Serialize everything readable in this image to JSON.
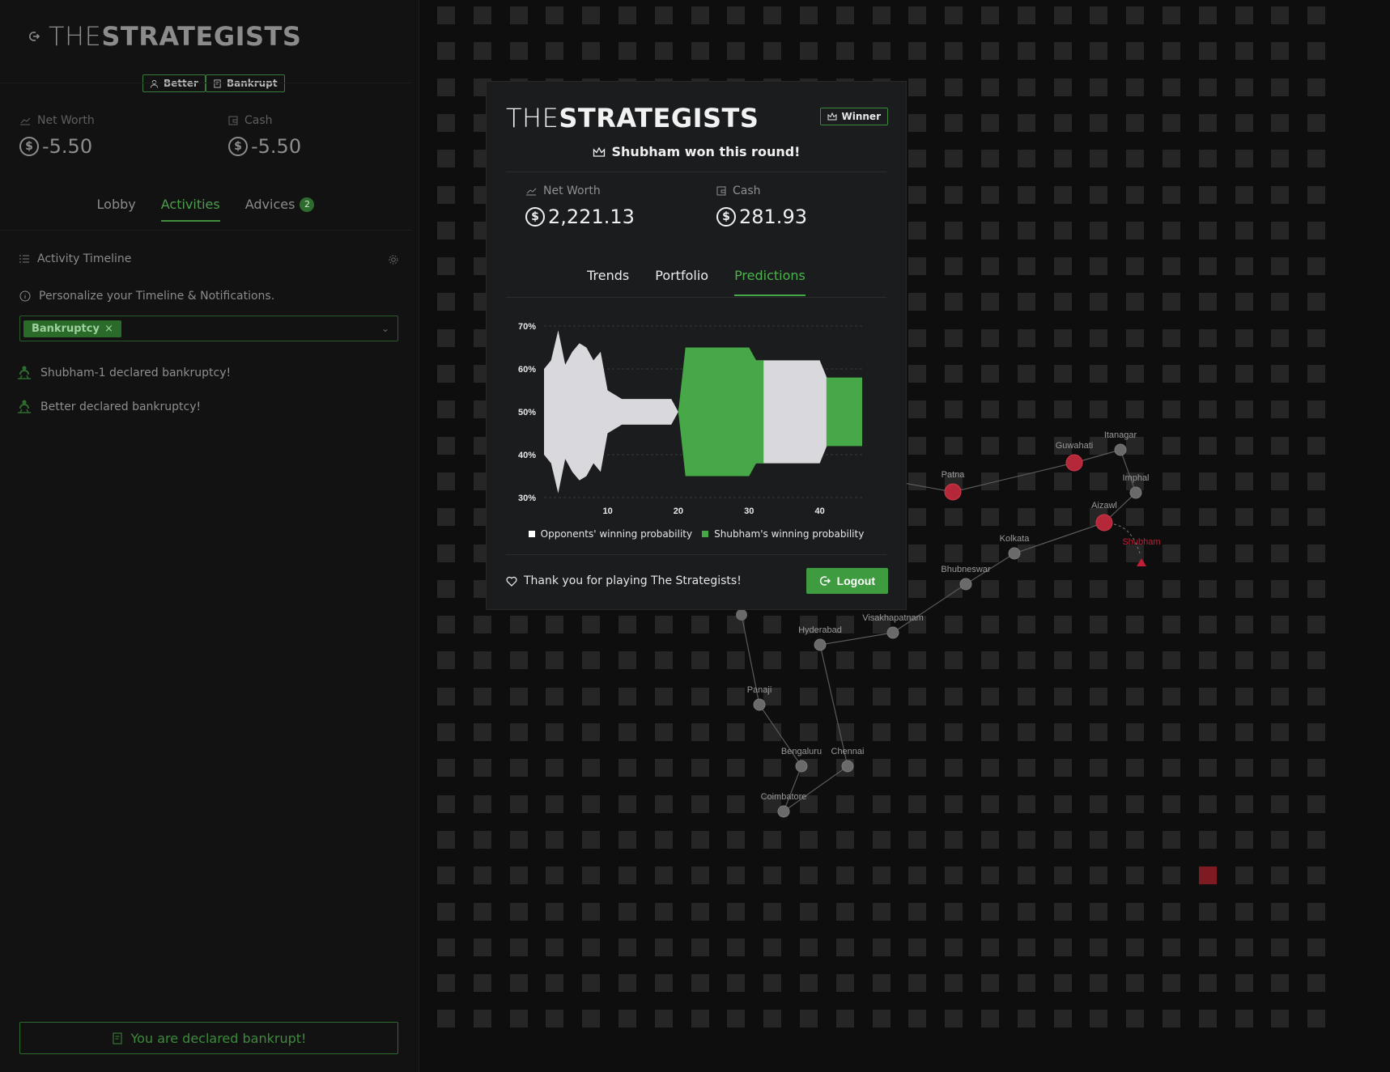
{
  "sidebar": {
    "brand_light": "THE",
    "brand_bold": "STRATEGISTS",
    "players": [
      {
        "label": "Better",
        "icon": "user-icon"
      },
      {
        "label": "Bankrupt",
        "icon": "receipt-icon"
      }
    ],
    "net_worth": {
      "label": "Net Worth",
      "value": "-5.50",
      "currency_symbol": "$"
    },
    "cash": {
      "label": "Cash",
      "value": "-5.50",
      "currency_symbol": "$"
    },
    "tabs": [
      {
        "label": "Lobby"
      },
      {
        "label": "Activities"
      },
      {
        "label": "Advices",
        "badge": "2"
      }
    ],
    "active_tab": "Activities",
    "timeline_title": "Activity Timeline",
    "personalize_text": "Personalize your Timeline & Notifications.",
    "filter_chip": "Bankruptcy",
    "activities": [
      "Shubham-1 declared bankruptcy!",
      "Better declared bankruptcy!"
    ],
    "bankrupt_banner": "You are declared bankrupt!"
  },
  "modal": {
    "brand_light": "THE",
    "brand_bold": "STRATEGISTS",
    "winner_badge": "Winner",
    "won_text": "Shubham won this round!",
    "net_worth": {
      "label": "Net Worth",
      "value": "2,221.13",
      "currency_symbol": "$"
    },
    "cash": {
      "label": "Cash",
      "value": "281.93",
      "currency_symbol": "$"
    },
    "tabs": [
      {
        "label": "Trends"
      },
      {
        "label": "Portfolio"
      },
      {
        "label": "Predictions"
      }
    ],
    "active_tab": "Predictions",
    "thanks_text": "Thank you for playing The Strategists!",
    "logout_label": "Logout"
  },
  "map": {
    "cities": [
      "Patna",
      "Guwahati",
      "Itanagar",
      "Imphal",
      "Aizawl",
      "Kolkata",
      "Bhubneswar",
      "Visakhapatnam",
      "Hyderabad",
      "Panaji",
      "Bengaluru",
      "Chennai",
      "Coimbatore"
    ],
    "player_marker": "Shubham"
  },
  "colors": {
    "accent": "#46a846",
    "opponent": "#d8d8dd",
    "danger": "#c21f35",
    "background": "#0e0e0e"
  },
  "chart_data": {
    "type": "area",
    "x_ticks": [
      10,
      20,
      30,
      40
    ],
    "y_ticks": [
      "30%",
      "40%",
      "50%",
      "60%",
      "70%"
    ],
    "xlim": [
      1,
      46
    ],
    "ylim": [
      30,
      70
    ],
    "series": [
      {
        "name": "Opponents' winning probability",
        "color": "#d8d8dd",
        "x": [
          1,
          2,
          3,
          4,
          5,
          6,
          7,
          8,
          9,
          10,
          12,
          15,
          17,
          18,
          19,
          20,
          21,
          22,
          23,
          24,
          25,
          26,
          27,
          28,
          29,
          30,
          31,
          32,
          33,
          34,
          35,
          36,
          37,
          38,
          39,
          40,
          41,
          42,
          43,
          44,
          45,
          46
        ],
        "values": [
          60,
          62,
          69,
          61,
          64,
          66,
          65,
          62,
          64,
          55,
          53,
          53,
          53,
          53,
          53,
          50,
          35,
          35,
          35,
          35,
          35,
          35,
          35,
          35,
          35,
          35,
          38,
          62,
          62,
          62,
          62,
          62,
          62,
          62,
          62,
          62,
          42,
          42,
          42,
          42,
          42,
          42
        ]
      },
      {
        "name": "Shubham's winning probability",
        "color": "#46a846",
        "x": [
          1,
          2,
          3,
          4,
          5,
          6,
          7,
          8,
          9,
          10,
          12,
          15,
          17,
          18,
          19,
          20,
          21,
          22,
          23,
          24,
          25,
          26,
          27,
          28,
          29,
          30,
          31,
          32,
          33,
          34,
          35,
          36,
          37,
          38,
          39,
          40,
          41,
          42,
          43,
          44,
          45,
          46
        ],
        "values": [
          40,
          38,
          31,
          39,
          36,
          34,
          35,
          38,
          36,
          45,
          47,
          47,
          47,
          47,
          47,
          50,
          65,
          65,
          65,
          65,
          65,
          65,
          65,
          65,
          65,
          65,
          62,
          38,
          38,
          38,
          38,
          38,
          38,
          38,
          38,
          38,
          58,
          58,
          58,
          58,
          58,
          58
        ]
      }
    ],
    "legend_position": "bottom"
  }
}
